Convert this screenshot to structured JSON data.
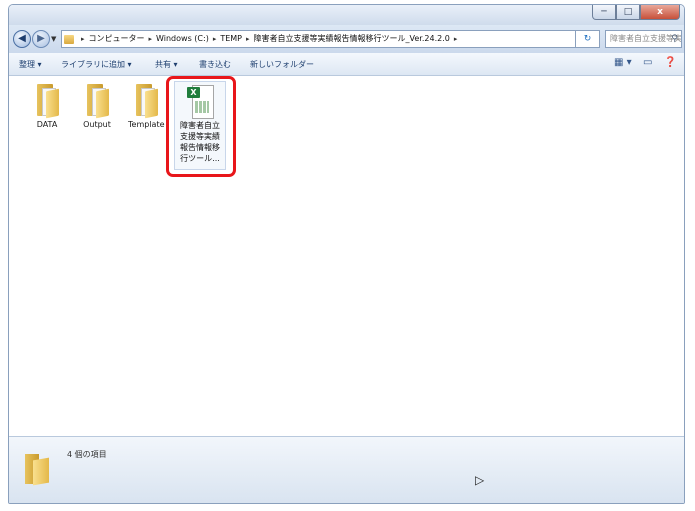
{
  "window": {
    "caption_buttons": {
      "minimize": "─",
      "maximize": "□",
      "close": "x"
    }
  },
  "address": {
    "back": "◀",
    "forward": "▶",
    "dropdown": "▼",
    "crumbs": [
      "コンピューター",
      "Windows (C:)",
      "TEMP",
      "障害者自立支援等実績報告情報移行ツール_Ver.24.2.0"
    ],
    "separator": "▸",
    "refresh": "↻",
    "search_placeholder": "障害者自立支援等実...",
    "search_icon": "search-icon"
  },
  "toolbar": {
    "organize": "整理 ▾",
    "add_library": "ライブラリに追加 ▾",
    "share": "共有 ▾",
    "burn": "書き込む",
    "new_folder": "新しいフォルダー",
    "view": "▦ ▾",
    "preview": "▭",
    "help": "❓"
  },
  "files": [
    {
      "name": "DATA",
      "type": "folder"
    },
    {
      "name": "Output",
      "type": "folder"
    },
    {
      "name": "Template",
      "type": "folder"
    },
    {
      "name": "障害者自立支援等実績報告情報移行ツール...",
      "type": "excel",
      "display_lines": [
        "障害者自立",
        "支援等実績",
        "報告情報移",
        "行ツール..."
      ]
    }
  ],
  "excel_badge": "X",
  "status": {
    "item_count": "4 個の項目"
  },
  "cursor": "▷",
  "colors": {
    "highlight": "#e8161a",
    "excel_green": "#1f7d3c",
    "folder": "#e4b849"
  }
}
